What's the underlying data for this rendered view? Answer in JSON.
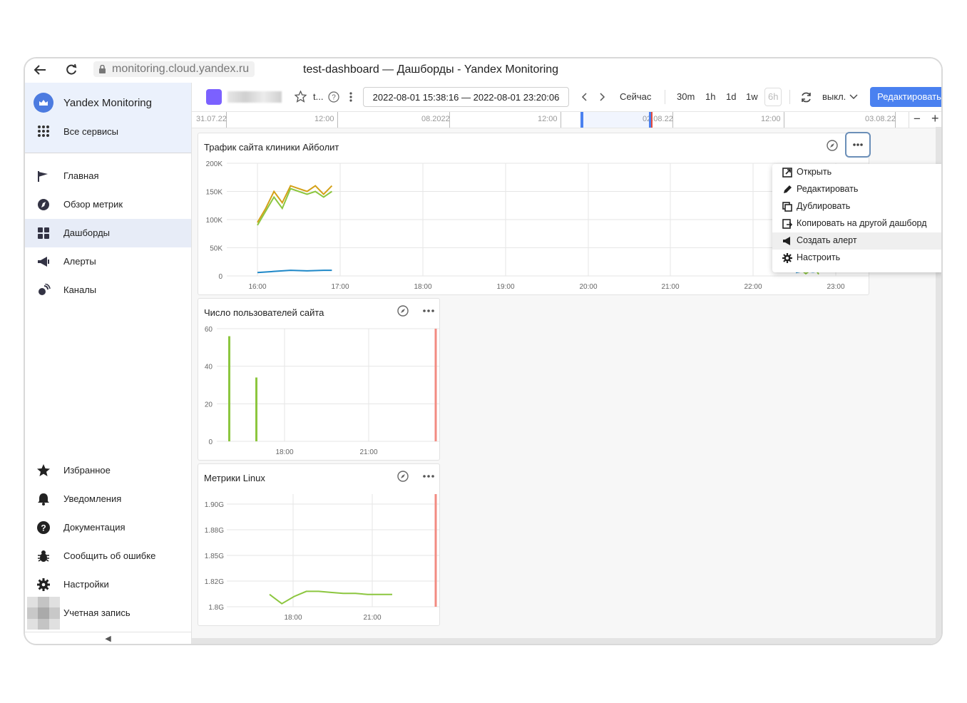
{
  "browser": {
    "url": "monitoring.cloud.yandex.ru",
    "title": "test-dashboard — Дашборды - Yandex Monitoring"
  },
  "sidebar": {
    "app_name": "Yandex Monitoring",
    "all_services": "Все сервисы",
    "nav": [
      {
        "label": "Главная",
        "icon": "flag-icon"
      },
      {
        "label": "Обзор метрик",
        "icon": "compass-icon"
      },
      {
        "label": "Дашборды",
        "icon": "dashboard-icon",
        "active": true
      },
      {
        "label": "Алерты",
        "icon": "megaphone-icon"
      },
      {
        "label": "Каналы",
        "icon": "satellite-icon"
      }
    ],
    "bottom": [
      {
        "label": "Избранное",
        "icon": "star-icon"
      },
      {
        "label": "Уведомления",
        "icon": "bell-icon"
      },
      {
        "label": "Документация",
        "icon": "help-icon"
      },
      {
        "label": "Сообщить об ошибке",
        "icon": "bug-icon"
      },
      {
        "label": "Настройки",
        "icon": "gear-icon"
      },
      {
        "label": "Учетная запись",
        "icon": "avatar"
      }
    ],
    "collapse_glyph": "◀"
  },
  "toolbar": {
    "dashboard_short": "t...",
    "time_range": "2022-08-01 15:38:16 — 2022-08-01 23:20:06",
    "now": "Сейчас",
    "ranges": [
      "30m",
      "1h",
      "1d",
      "1w",
      "6h"
    ],
    "refresh": "выкл.",
    "edit": "Редактировать"
  },
  "timeline": {
    "labels": [
      "31.07.22",
      "12:00",
      "08.2022",
      "12:00",
      "02.08.22",
      "12:00",
      "03.08.22"
    ],
    "zoom_out": "−",
    "zoom_in": "+"
  },
  "panels": {
    "traffic": {
      "title": "Трафик сайта клиники Айболит"
    },
    "users": {
      "title": "Число пользователей сайта"
    },
    "linux": {
      "title": "Метрики Linux"
    }
  },
  "menu": {
    "items": [
      {
        "label": "Открыть",
        "icon": "open-icon"
      },
      {
        "label": "Редактировать",
        "icon": "pencil-icon"
      },
      {
        "label": "Дублировать",
        "icon": "duplicate-icon"
      },
      {
        "label": "Копировать на другой дашборд",
        "icon": "copy-icon"
      },
      {
        "label": "Создать алерт",
        "icon": "megaphone-icon",
        "highlighted": true
      },
      {
        "label": "Настроить",
        "icon": "gear-icon"
      }
    ]
  },
  "colors": {
    "accent": "#4a81f0",
    "series_green": "#8cc63f",
    "series_yellow": "#d4a017",
    "series_blue": "#1e88c8",
    "now_line": "#f28b82"
  },
  "chart_data": [
    {
      "type": "line",
      "title": "Трафик сайта клиники Айболит",
      "x_ticks": [
        "16:00",
        "17:00",
        "18:00",
        "19:00",
        "20:00",
        "21:00",
        "22:00",
        "23:00"
      ],
      "y_ticks": [
        "0",
        "50K",
        "100K",
        "150K",
        "200K"
      ],
      "ylim": [
        0,
        200000
      ],
      "series": [
        {
          "color": "#d4a017",
          "x": [
            16.0,
            16.1,
            16.2,
            16.3,
            16.4,
            16.5,
            16.6,
            16.7,
            16.8,
            16.9
          ],
          "y": [
            95000,
            120000,
            150000,
            130000,
            160000,
            155000,
            150000,
            160000,
            145000,
            160000
          ]
        },
        {
          "color": "#8cc63f",
          "x": [
            16.0,
            16.1,
            16.2,
            16.3,
            16.4,
            16.5,
            16.6,
            16.7,
            16.8,
            16.9
          ],
          "y": [
            90000,
            115000,
            140000,
            120000,
            155000,
            150000,
            145000,
            150000,
            140000,
            150000
          ]
        },
        {
          "color": "#1e88c8",
          "x": [
            16.0,
            16.2,
            16.4,
            16.6,
            16.8,
            16.9
          ],
          "y": [
            6000,
            8000,
            10000,
            9000,
            10000,
            10000
          ]
        }
      ]
    },
    {
      "type": "bar",
      "title": "Число пользователей сайта",
      "x_ticks": [
        "18:00",
        "21:00"
      ],
      "y_ticks": [
        "0",
        "20",
        "40",
        "60"
      ],
      "ylim": [
        0,
        60
      ],
      "values": [
        56,
        34
      ]
    },
    {
      "type": "line",
      "title": "Метрики Linux",
      "x_ticks": [
        "18:00",
        "21:00"
      ],
      "y_ticks": [
        "1.8G",
        "1.82G",
        "1.85G",
        "1.88G",
        "1.90G"
      ],
      "series": [
        {
          "color": "#8cc63f",
          "values": [
            1.812,
            1.803,
            1.81,
            1.815,
            1.815,
            1.814,
            1.813,
            1.813,
            1.812,
            1.812,
            1.812
          ]
        }
      ]
    }
  ]
}
